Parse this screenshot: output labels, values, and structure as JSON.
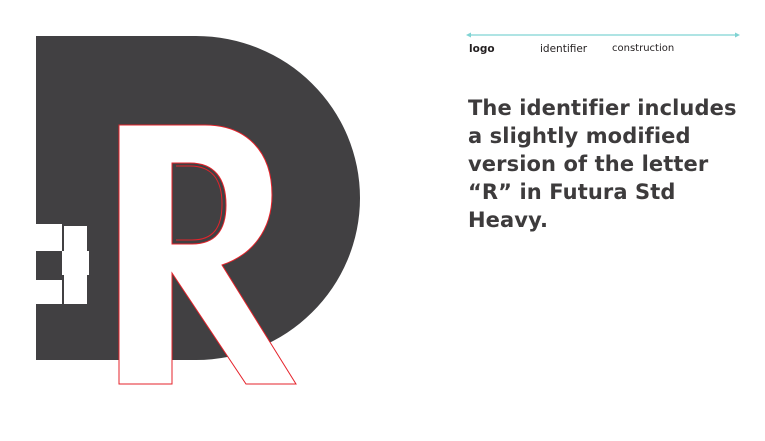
{
  "colors": {
    "mark_fill": "#414042",
    "construction_outline": "#e5232b",
    "nav_rule": "#7fd3d3",
    "text": "#3d3b3c",
    "background": "#ffffff"
  },
  "icons": {
    "artwork": "d-plus-r-identifier-mark",
    "nav_rule": "double-arrow-line-icon"
  },
  "nav": {
    "items": [
      {
        "label": "logo",
        "active": true
      },
      {
        "label": "identifier",
        "active": false
      },
      {
        "label": "construction",
        "active": false
      }
    ]
  },
  "description": {
    "text": "The identifier includes a slightly modified version of the letter “R” in Futura Std Heavy."
  }
}
